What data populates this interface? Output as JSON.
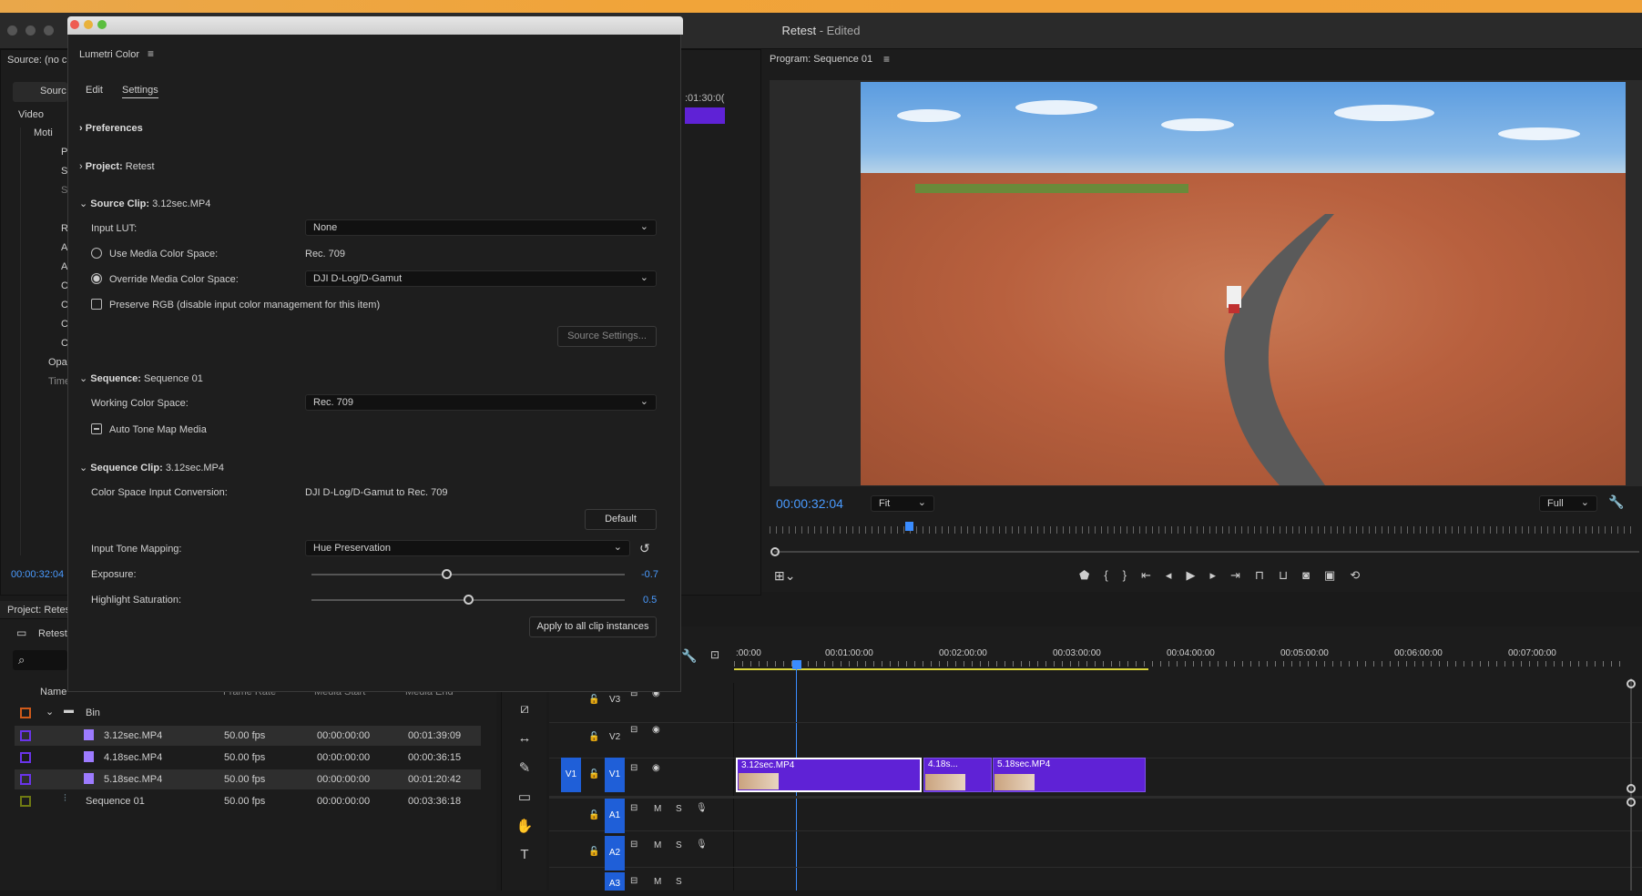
{
  "window": {
    "title": "Retest",
    "subtitle": "- Edited"
  },
  "source_panel": {
    "header": "Source: (no cl",
    "tab": "Sourc",
    "video_label": "Video",
    "items": [
      "Moti",
      "P",
      "S",
      "S",
      "R",
      "A",
      "A",
      "C",
      "C",
      "C",
      "C",
      "Opa",
      "Time"
    ],
    "timecode": "00:00:32:04",
    "ruler_time": ":01:30:0("
  },
  "lumetri": {
    "title": "Lumetri Color",
    "tabs": [
      "Edit",
      "Settings"
    ],
    "preferences": "Preferences",
    "project_label": "Project:",
    "project_value": "Retest",
    "source_clip_label": "Source Clip:",
    "source_clip_value": "3.12sec.MP4",
    "input_lut_label": "Input LUT:",
    "input_lut_value": "None",
    "use_media_cs_label": "Use Media Color Space:",
    "use_media_cs_value": "Rec. 709",
    "override_cs_label": "Override Media Color Space:",
    "override_cs_value": "DJI D-Log/D-Gamut",
    "preserve_rgb_label": "Preserve RGB (disable input color management for this item)",
    "source_settings_btn": "Source Settings...",
    "sequence_label": "Sequence:",
    "sequence_value": "Sequence 01",
    "working_cs_label": "Working Color Space:",
    "working_cs_value": "Rec. 709",
    "auto_tone_label": "Auto Tone Map Media",
    "sequence_clip_label": "Sequence Clip:",
    "sequence_clip_value": "3.12sec.MP4",
    "cs_input_conv_label": "Color Space Input Conversion:",
    "cs_input_conv_value": "DJI D-Log/D-Gamut to Rec. 709",
    "default_btn": "Default",
    "input_tone_label": "Input Tone Mapping:",
    "input_tone_value": "Hue Preservation",
    "exposure_label": "Exposure:",
    "exposure_value": "-0.7",
    "exposure_level": 0.43,
    "highlight_label": "Highlight Saturation:",
    "highlight_value": "0.5",
    "highlight_level": 0.5,
    "apply_btn": "Apply to all clip instances"
  },
  "program": {
    "header": "Program: Sequence 01",
    "timecode": "00:00:32:04",
    "fit": "Fit",
    "quality": "Full"
  },
  "timeline": {
    "ruler": [
      ":00:00",
      "00:01:00:00",
      "00:02:00:00",
      "00:03:00:00",
      "00:04:00:00",
      "00:05:00:00",
      "00:06:00:00",
      "00:07:00:00"
    ],
    "tracks_video": [
      "V3",
      "V2",
      "V1"
    ],
    "tracks_audio": [
      "A1",
      "A2",
      "A3"
    ],
    "v1_source": "V1",
    "clips": [
      "3.12sec.MP4",
      "4.18s...",
      "5.18sec.MP4"
    ],
    "m": "M",
    "s": "S",
    "accent": "#5f22d6"
  },
  "project": {
    "header": "Project: Retes",
    "bin_name": "Retest",
    "columns": [
      "Name",
      "Frame Rate",
      "Media Start",
      "Media End"
    ],
    "folder": "Bin",
    "rows": [
      {
        "name": "3.12sec.MP4",
        "fps": "50.00 fps",
        "start": "00:00:00:00",
        "end": "00:01:39:09"
      },
      {
        "name": "4.18sec.MP4",
        "fps": "50.00 fps",
        "start": "00:00:00:00",
        "end": "00:00:36:15"
      },
      {
        "name": "5.18sec.MP4",
        "fps": "50.00 fps",
        "start": "00:00:00:00",
        "end": "00:01:20:42"
      },
      {
        "name": "Sequence 01",
        "fps": "50.00 fps",
        "start": "00:00:00:00",
        "end": "00:03:36:18"
      }
    ]
  }
}
